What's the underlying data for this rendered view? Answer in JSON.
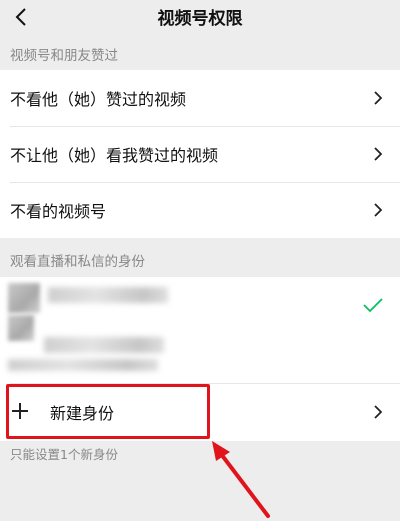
{
  "nav": {
    "title": "视频号权限",
    "back_icon": "chevron-left-icon"
  },
  "sections": {
    "likes_header": "视频号和朋友赞过",
    "identity_header": "观看直播和私信的身份"
  },
  "likes_rows": [
    {
      "label": "不看他（她）赞过的视频"
    },
    {
      "label": "不让他（她）看我赞过的视频"
    },
    {
      "label": "不看的视频号"
    }
  ],
  "identity": {
    "selected_icon": "checkmark-icon",
    "accent_color": "#07c160",
    "new_identity_label": "新建身份",
    "footnote": "只能设置1个新身份"
  },
  "annotation": {
    "highlight_color": "#e0151b"
  }
}
